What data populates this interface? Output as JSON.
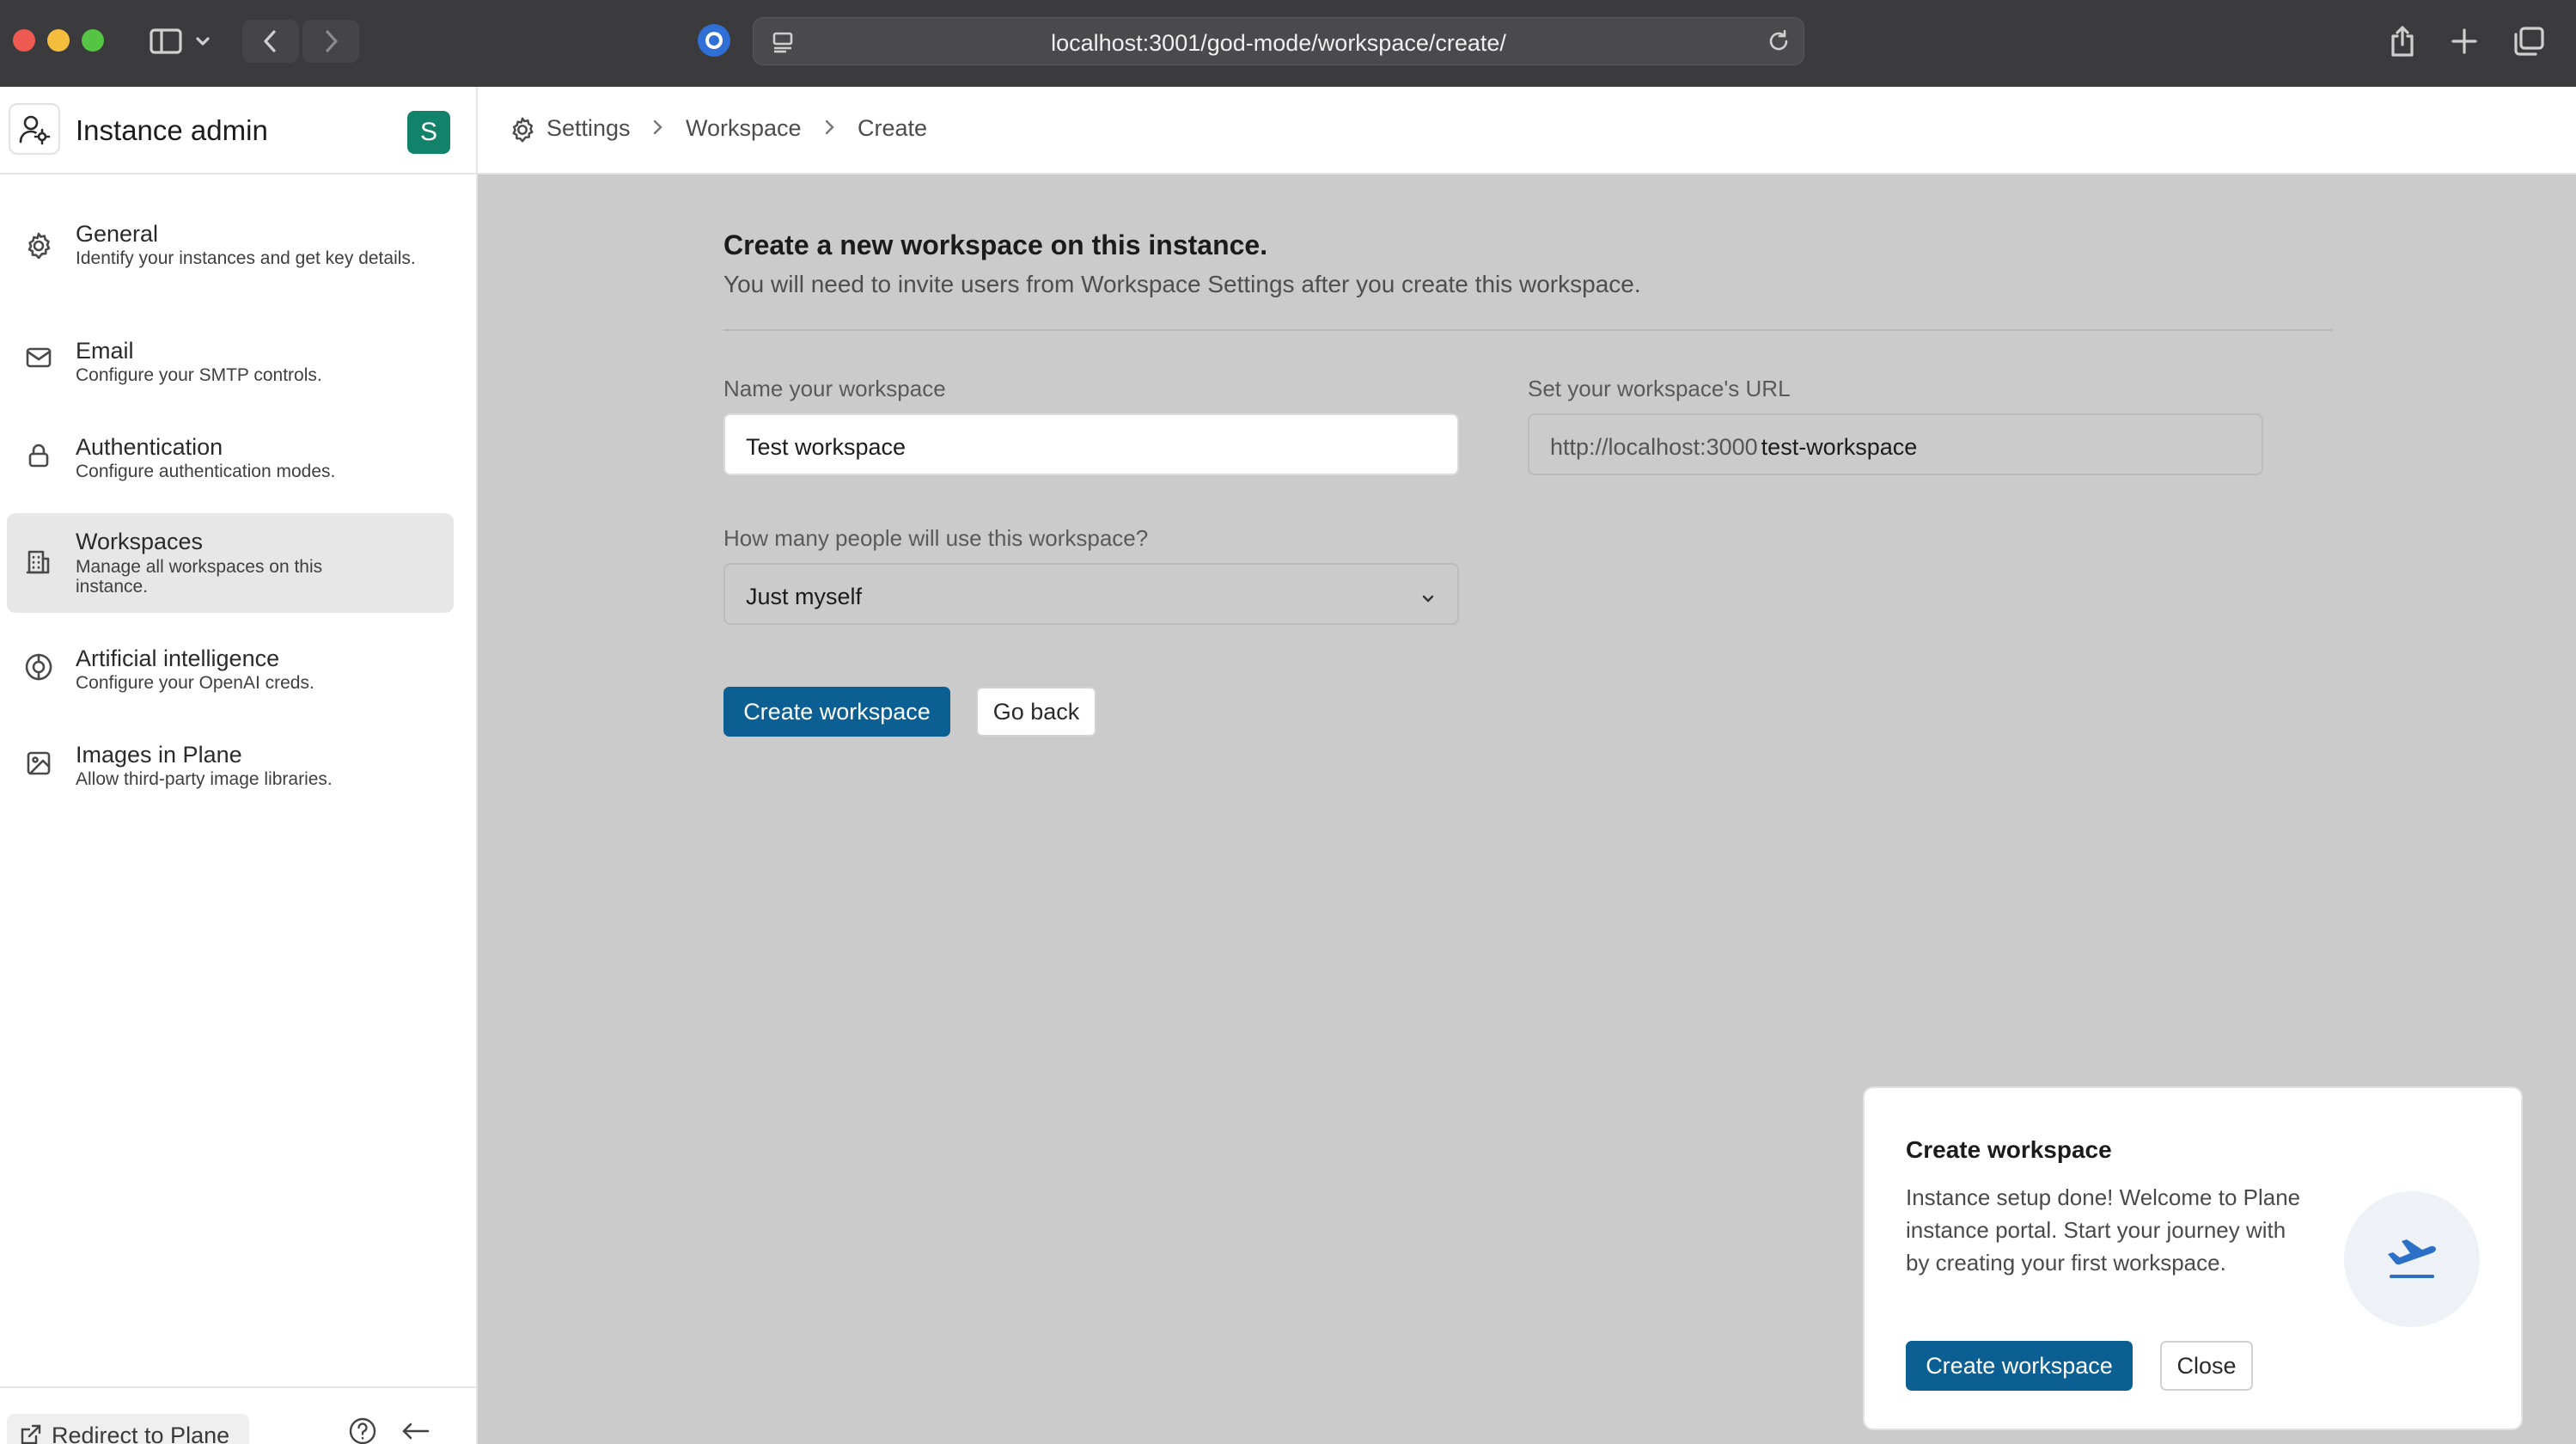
{
  "browser": {
    "url": "localhost:3001/god-mode/workspace/create/"
  },
  "sidebar": {
    "title": "Instance admin",
    "avatar_letter": "S",
    "items": [
      {
        "title": "General",
        "desc": "Identify your instances and get key details.",
        "icon": "gear-icon"
      },
      {
        "title": "Email",
        "desc": "Configure your SMTP controls.",
        "icon": "mail-icon"
      },
      {
        "title": "Authentication",
        "desc": "Configure authentication modes.",
        "icon": "lock-icon"
      },
      {
        "title": "Workspaces",
        "desc": "Manage all workspaces on this instance.",
        "icon": "building-icon",
        "active": true
      },
      {
        "title": "Artificial intelligence",
        "desc": "Configure your OpenAI creds.",
        "icon": "ai-icon"
      },
      {
        "title": "Images in Plane",
        "desc": "Allow third-party image libraries.",
        "icon": "image-icon"
      }
    ],
    "footer": {
      "redirect_label": "Redirect to Plane"
    }
  },
  "breadcrumb": {
    "items": [
      "Settings",
      "Workspace",
      "Create"
    ]
  },
  "form": {
    "title": "Create a new workspace on this instance.",
    "subtitle": "You will need to invite users from Workspace Settings after you create this workspace.",
    "name_label": "Name your workspace",
    "name_value": "Test workspace",
    "url_label": "Set your workspace's URL",
    "url_prefix": "http://localhost:3000",
    "url_slug": "test-workspace",
    "size_label": "How many people will use this workspace?",
    "size_value": "Just myself",
    "create_button": "Create workspace",
    "back_button": "Go back"
  },
  "toast": {
    "title": "Create workspace",
    "body": "Instance setup done! Welcome to Plane instance portal. Start your journey with by creating your first workspace.",
    "create_button": "Create workspace",
    "close_button": "Close"
  },
  "colors": {
    "primary": "#0b5f93",
    "avatar": "#12836a",
    "main_bg": "#cbcbcb"
  }
}
